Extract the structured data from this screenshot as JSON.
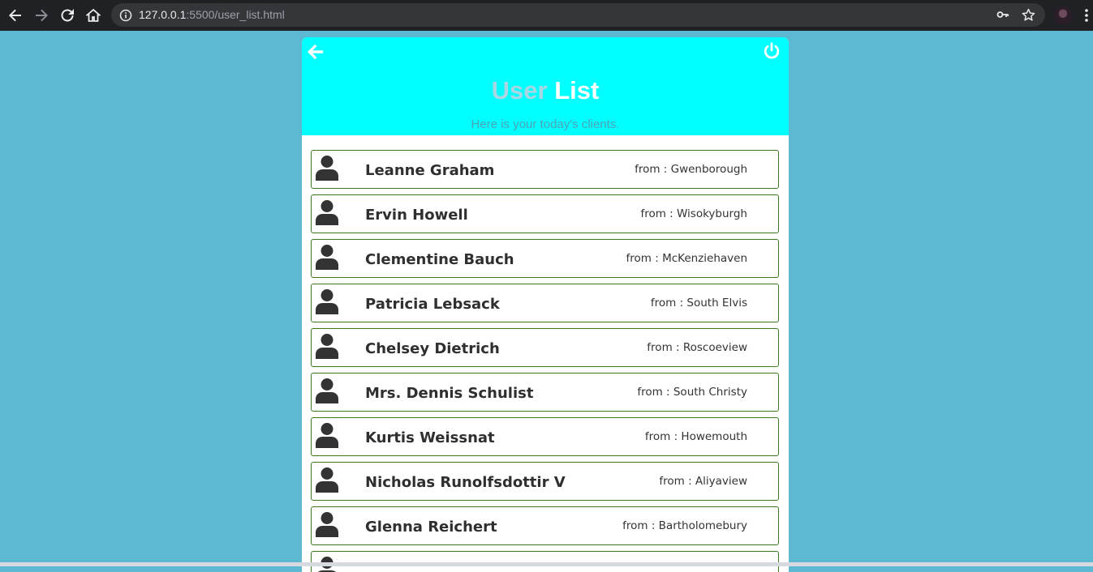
{
  "browser": {
    "url_host": "127.0.0.1",
    "url_rest": ":5500/user_list.html"
  },
  "header": {
    "title_part1": "User",
    "title_part2": "List",
    "subtitle": "Here is your today's clients."
  },
  "from_prefix": "from : ",
  "users": [
    {
      "name": "Leanne Graham",
      "from": "from : Gwenborough"
    },
    {
      "name": "Ervin Howell",
      "from": "from : Wisokyburgh"
    },
    {
      "name": "Clementine Bauch",
      "from": "from : McKenziehaven"
    },
    {
      "name": "Patricia Lebsack",
      "from": "from : South Elvis"
    },
    {
      "name": "Chelsey Dietrich",
      "from": "from : Roscoeview"
    },
    {
      "name": "Mrs. Dennis Schulist",
      "from": "from : South Christy"
    },
    {
      "name": "Kurtis Weissnat",
      "from": "from : Howemouth"
    },
    {
      "name": "Nicholas Runolfsdottir V",
      "from": "from : Aliyaview"
    },
    {
      "name": "Glenna Reichert",
      "from": "from : Bartholomebury"
    },
    {
      "name": "",
      "from": ""
    }
  ],
  "colors": {
    "page_bg": "#5cb9d1",
    "header_bg": "#00ffff",
    "row_border": "#3b7a1f"
  }
}
